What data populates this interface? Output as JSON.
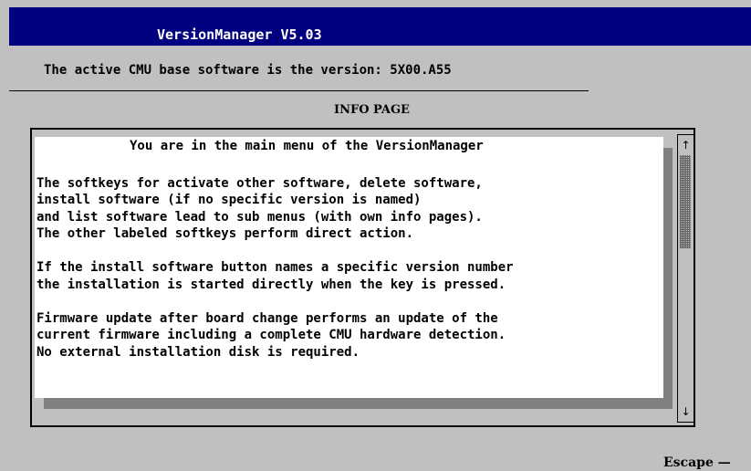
{
  "window": {
    "title": "VersionManager V5.03",
    "title_bar_color": "#000080",
    "background_color": "#c0c0c0"
  },
  "status": {
    "text": "The active CMU base software is the version: 5X00.A55"
  },
  "info": {
    "heading": "INFO PAGE",
    "lines": [
      "You are in the main menu of the VersionManager",
      "",
      "The softkeys for activate other software, delete software,",
      "install software (if no specific version is named)",
      "and list software lead to sub menus (with own info pages).",
      "The other labeled softkeys perform direct action.",
      "",
      "If the install software button names a specific version number",
      "the installation is started directly when the key is pressed.",
      "",
      "Firmware update after board change performs an update of the",
      "current firmware including a complete CMU hardware detection.",
      "No external installation disk is required."
    ]
  },
  "scrollbar": {
    "up_icon": "↑",
    "down_icon": "↓"
  },
  "softkeys": {
    "escape_label": "Escape —"
  }
}
